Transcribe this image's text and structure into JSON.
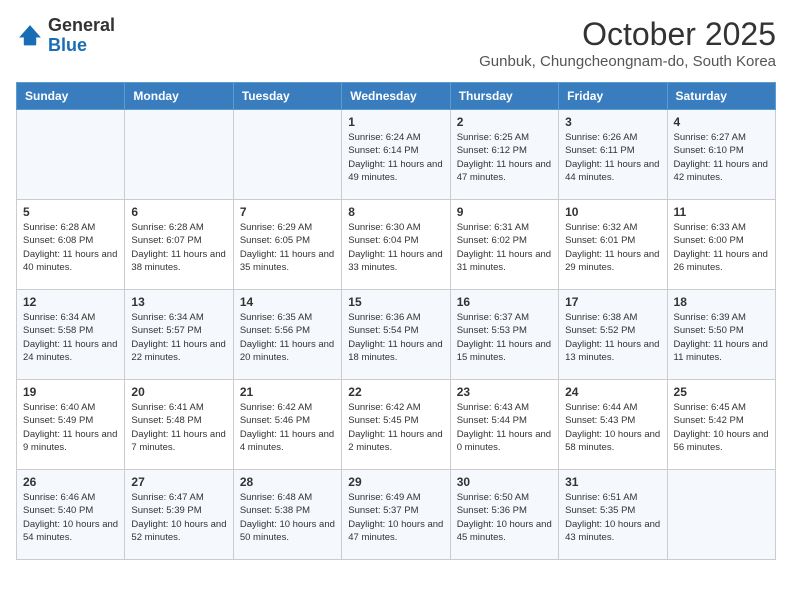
{
  "logo": {
    "general": "General",
    "blue": "Blue"
  },
  "header": {
    "month": "October 2025",
    "location": "Gunbuk, Chungcheongnam-do, South Korea"
  },
  "days_of_week": [
    "Sunday",
    "Monday",
    "Tuesday",
    "Wednesday",
    "Thursday",
    "Friday",
    "Saturday"
  ],
  "weeks": [
    [
      {
        "day": "",
        "info": ""
      },
      {
        "day": "",
        "info": ""
      },
      {
        "day": "",
        "info": ""
      },
      {
        "day": "1",
        "info": "Sunrise: 6:24 AM\nSunset: 6:14 PM\nDaylight: 11 hours\nand 49 minutes."
      },
      {
        "day": "2",
        "info": "Sunrise: 6:25 AM\nSunset: 6:12 PM\nDaylight: 11 hours\nand 47 minutes."
      },
      {
        "day": "3",
        "info": "Sunrise: 6:26 AM\nSunset: 6:11 PM\nDaylight: 11 hours\nand 44 minutes."
      },
      {
        "day": "4",
        "info": "Sunrise: 6:27 AM\nSunset: 6:10 PM\nDaylight: 11 hours\nand 42 minutes."
      }
    ],
    [
      {
        "day": "5",
        "info": "Sunrise: 6:28 AM\nSunset: 6:08 PM\nDaylight: 11 hours\nand 40 minutes."
      },
      {
        "day": "6",
        "info": "Sunrise: 6:28 AM\nSunset: 6:07 PM\nDaylight: 11 hours\nand 38 minutes."
      },
      {
        "day": "7",
        "info": "Sunrise: 6:29 AM\nSunset: 6:05 PM\nDaylight: 11 hours\nand 35 minutes."
      },
      {
        "day": "8",
        "info": "Sunrise: 6:30 AM\nSunset: 6:04 PM\nDaylight: 11 hours\nand 33 minutes."
      },
      {
        "day": "9",
        "info": "Sunrise: 6:31 AM\nSunset: 6:02 PM\nDaylight: 11 hours\nand 31 minutes."
      },
      {
        "day": "10",
        "info": "Sunrise: 6:32 AM\nSunset: 6:01 PM\nDaylight: 11 hours\nand 29 minutes."
      },
      {
        "day": "11",
        "info": "Sunrise: 6:33 AM\nSunset: 6:00 PM\nDaylight: 11 hours\nand 26 minutes."
      }
    ],
    [
      {
        "day": "12",
        "info": "Sunrise: 6:34 AM\nSunset: 5:58 PM\nDaylight: 11 hours\nand 24 minutes."
      },
      {
        "day": "13",
        "info": "Sunrise: 6:34 AM\nSunset: 5:57 PM\nDaylight: 11 hours\nand 22 minutes."
      },
      {
        "day": "14",
        "info": "Sunrise: 6:35 AM\nSunset: 5:56 PM\nDaylight: 11 hours\nand 20 minutes."
      },
      {
        "day": "15",
        "info": "Sunrise: 6:36 AM\nSunset: 5:54 PM\nDaylight: 11 hours\nand 18 minutes."
      },
      {
        "day": "16",
        "info": "Sunrise: 6:37 AM\nSunset: 5:53 PM\nDaylight: 11 hours\nand 15 minutes."
      },
      {
        "day": "17",
        "info": "Sunrise: 6:38 AM\nSunset: 5:52 PM\nDaylight: 11 hours\nand 13 minutes."
      },
      {
        "day": "18",
        "info": "Sunrise: 6:39 AM\nSunset: 5:50 PM\nDaylight: 11 hours\nand 11 minutes."
      }
    ],
    [
      {
        "day": "19",
        "info": "Sunrise: 6:40 AM\nSunset: 5:49 PM\nDaylight: 11 hours\nand 9 minutes."
      },
      {
        "day": "20",
        "info": "Sunrise: 6:41 AM\nSunset: 5:48 PM\nDaylight: 11 hours\nand 7 minutes."
      },
      {
        "day": "21",
        "info": "Sunrise: 6:42 AM\nSunset: 5:46 PM\nDaylight: 11 hours\nand 4 minutes."
      },
      {
        "day": "22",
        "info": "Sunrise: 6:42 AM\nSunset: 5:45 PM\nDaylight: 11 hours\nand 2 minutes."
      },
      {
        "day": "23",
        "info": "Sunrise: 6:43 AM\nSunset: 5:44 PM\nDaylight: 11 hours\nand 0 minutes."
      },
      {
        "day": "24",
        "info": "Sunrise: 6:44 AM\nSunset: 5:43 PM\nDaylight: 10 hours\nand 58 minutes."
      },
      {
        "day": "25",
        "info": "Sunrise: 6:45 AM\nSunset: 5:42 PM\nDaylight: 10 hours\nand 56 minutes."
      }
    ],
    [
      {
        "day": "26",
        "info": "Sunrise: 6:46 AM\nSunset: 5:40 PM\nDaylight: 10 hours\nand 54 minutes."
      },
      {
        "day": "27",
        "info": "Sunrise: 6:47 AM\nSunset: 5:39 PM\nDaylight: 10 hours\nand 52 minutes."
      },
      {
        "day": "28",
        "info": "Sunrise: 6:48 AM\nSunset: 5:38 PM\nDaylight: 10 hours\nand 50 minutes."
      },
      {
        "day": "29",
        "info": "Sunrise: 6:49 AM\nSunset: 5:37 PM\nDaylight: 10 hours\nand 47 minutes."
      },
      {
        "day": "30",
        "info": "Sunrise: 6:50 AM\nSunset: 5:36 PM\nDaylight: 10 hours\nand 45 minutes."
      },
      {
        "day": "31",
        "info": "Sunrise: 6:51 AM\nSunset: 5:35 PM\nDaylight: 10 hours\nand 43 minutes."
      },
      {
        "day": "",
        "info": ""
      }
    ]
  ]
}
